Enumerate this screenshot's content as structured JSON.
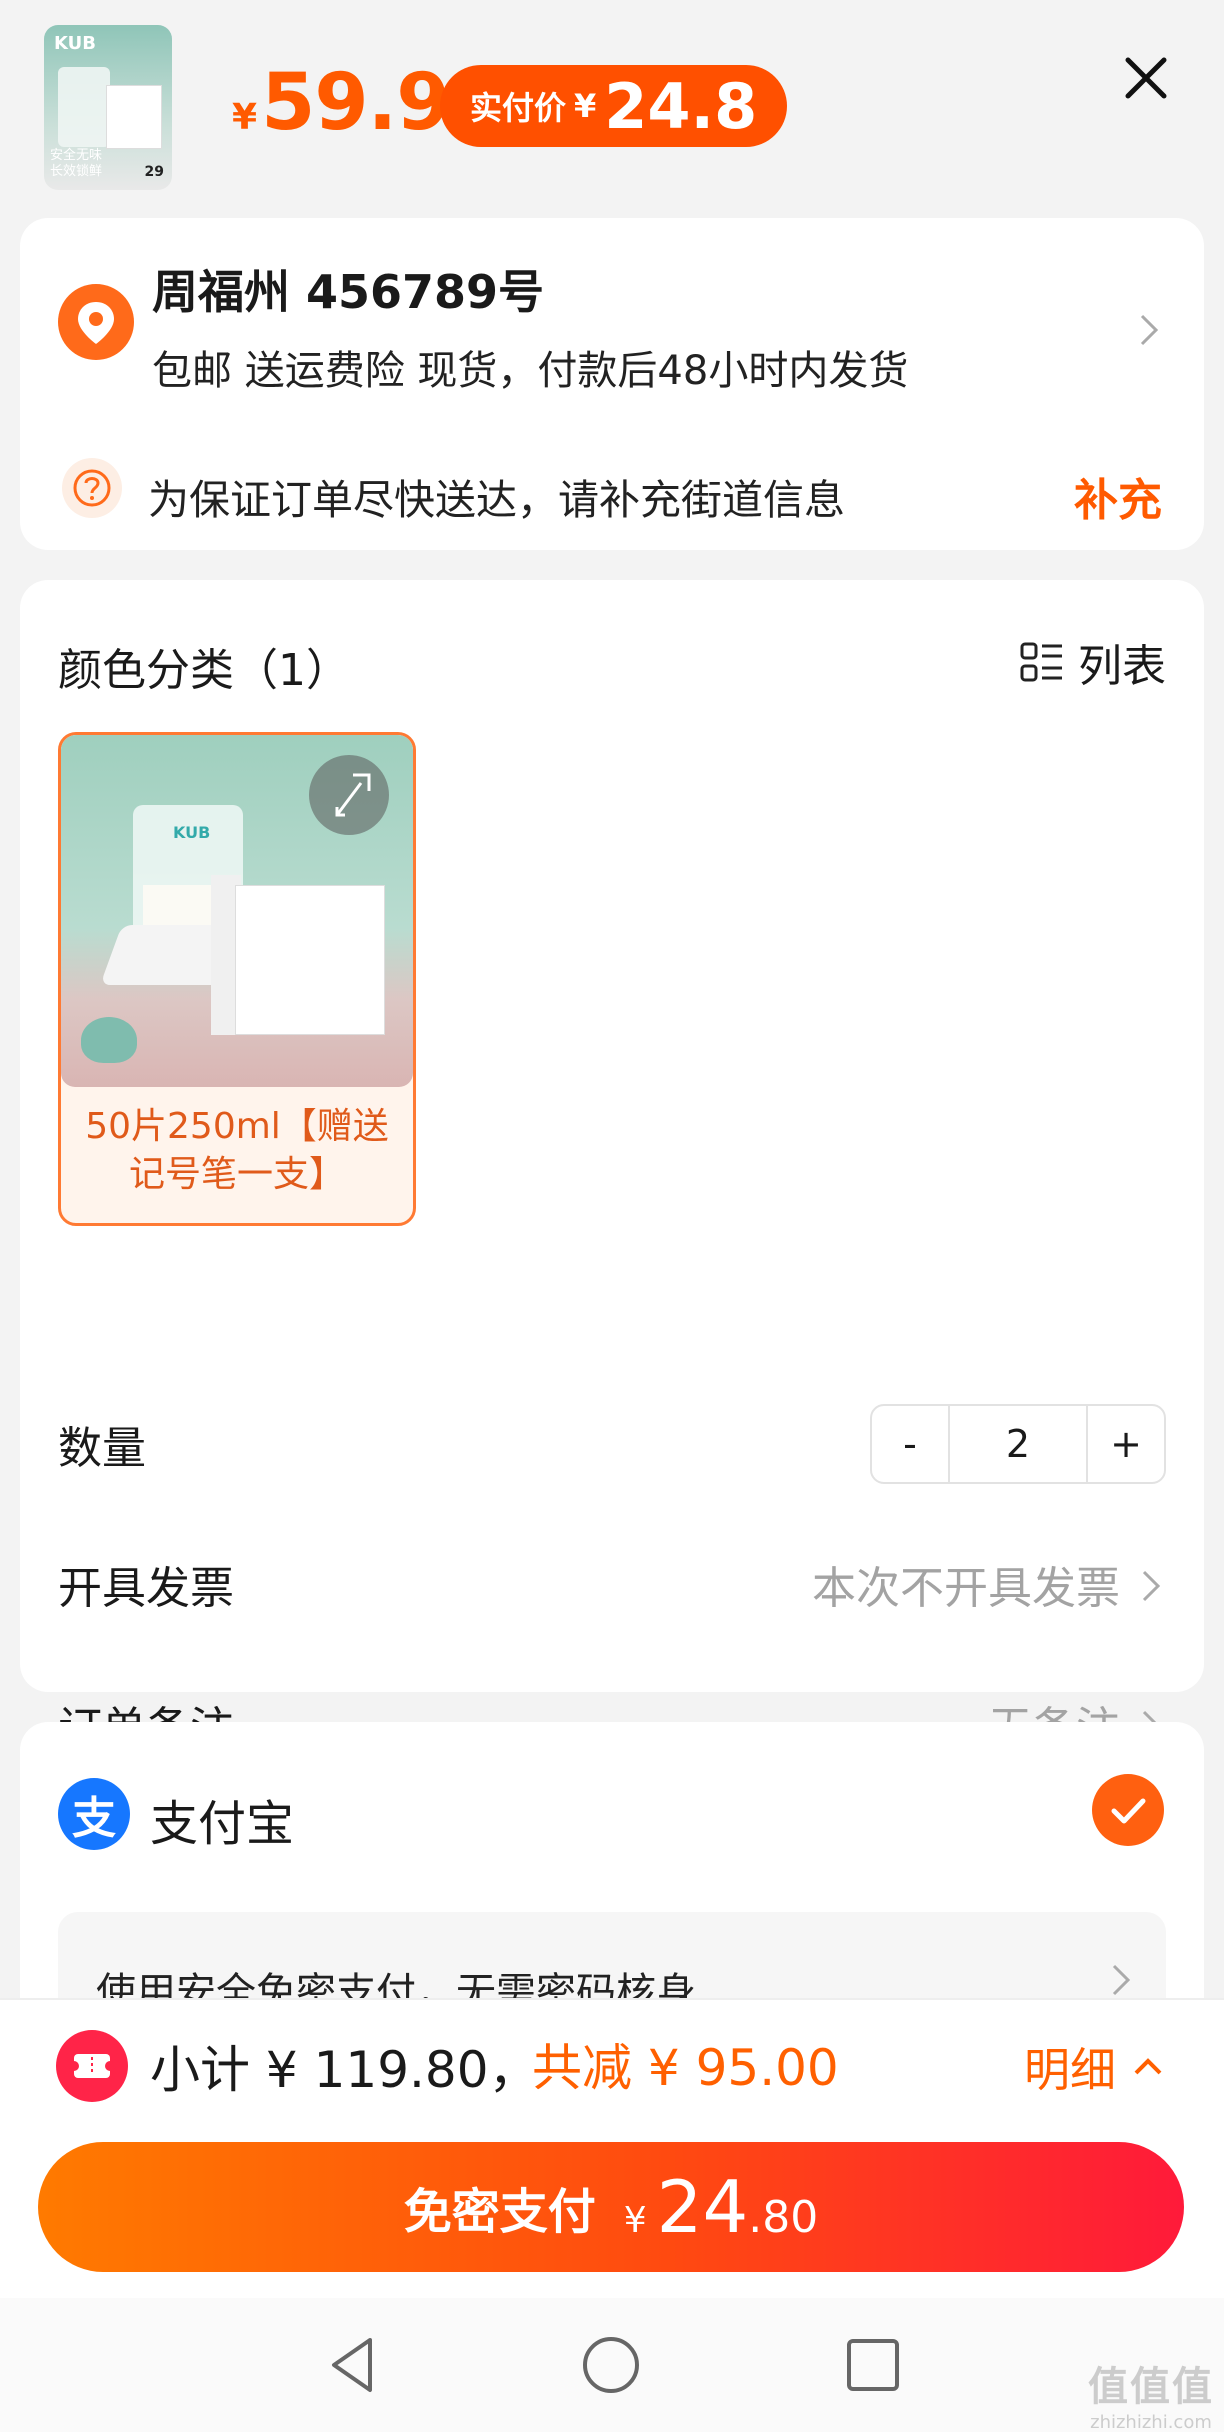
{
  "header": {
    "product_thumb": {
      "brand": "KUB",
      "caption_line1": "安全无味",
      "caption_line2": "长效锁鲜",
      "price": "29"
    },
    "original_price": {
      "currency": "¥",
      "amount": "59.9"
    },
    "paid_price": {
      "label": "实付价",
      "currency": "¥",
      "amount": "24.8"
    },
    "close_icon": "close-icon"
  },
  "address": {
    "name": "周福州 456789号",
    "info": "包邮  送运费险  现货，付款后48小时内发货",
    "hint": "为保证订单尽快送达，请补充街道信息",
    "hint_action": "补充"
  },
  "spec": {
    "title": "颜色分类（1）",
    "list_toggle": "列表",
    "sku": {
      "brand": "KUB",
      "name": "50片250ml【赠送记号笔一支】"
    },
    "quantity": {
      "label": "数量",
      "minus": "-",
      "value": "2",
      "plus": "+"
    },
    "invoice": {
      "label": "开具发票",
      "value": "本次不开具发票"
    },
    "note": {
      "label": "订单备注",
      "value": "无备注"
    }
  },
  "payment": {
    "method": "支付宝",
    "icon_char": "支",
    "selected": true,
    "note": "使用安全免密支付，无需密码核身"
  },
  "summary": {
    "subtotal": "小计 ¥ 119.80，",
    "discount": "共减 ¥ 95.00",
    "detail": "明细"
  },
  "pay_button": {
    "label": "免密支付",
    "currency": "¥",
    "int": "24",
    "dec": ".80"
  },
  "watermark": {
    "big": "值值值",
    "small": "zhizhizhi.com"
  },
  "colors": {
    "accent": "#ff5000",
    "alipay": "#1677ff",
    "pay_gradient_end": "#ff1a3a"
  }
}
